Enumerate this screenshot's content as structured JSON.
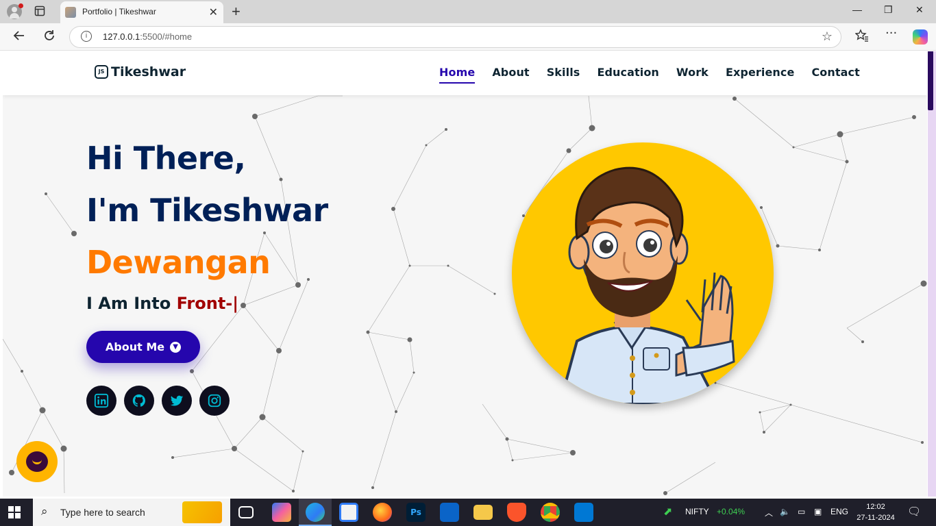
{
  "browser": {
    "tab_title": "Portfolio | Tikeshwar",
    "tab_close": "✕",
    "new_tab": "+",
    "url_host": "127.0.0.1",
    "url_rest": ":5500/#home",
    "window_minimize": "—",
    "window_restore": "❐",
    "window_close": "✕"
  },
  "site": {
    "logo_badge": "JS",
    "logo_text": "Tikeshwar",
    "nav": [
      {
        "label": "Home",
        "active": true
      },
      {
        "label": "About",
        "active": false
      },
      {
        "label": "Skills",
        "active": false
      },
      {
        "label": "Education",
        "active": false
      },
      {
        "label": "Work",
        "active": false
      },
      {
        "label": "Experience",
        "active": false
      },
      {
        "label": "Contact",
        "active": false
      }
    ]
  },
  "hero": {
    "line1": "Hi There,",
    "line2": "I'm Tikeshwar",
    "line3": "Dewangan",
    "typed_prefix": "I Am Into ",
    "typed_text": "Front-|",
    "button_label": "About Me",
    "socials": [
      "linkedin-icon",
      "github-icon",
      "twitter-icon",
      "instagram-icon"
    ]
  },
  "colors": {
    "primary": "#2506ad",
    "heading": "#002057",
    "accent": "#ff7a00",
    "typed": "#a10000",
    "avatar_bg": "#ffc800",
    "social_icon": "#00bcd4"
  },
  "taskbar": {
    "search_placeholder": "Type here to search",
    "market_name": "NIFTY",
    "market_change": "+0.04%",
    "language": "ENG",
    "time": "12:02",
    "date": "27-11-2024"
  }
}
